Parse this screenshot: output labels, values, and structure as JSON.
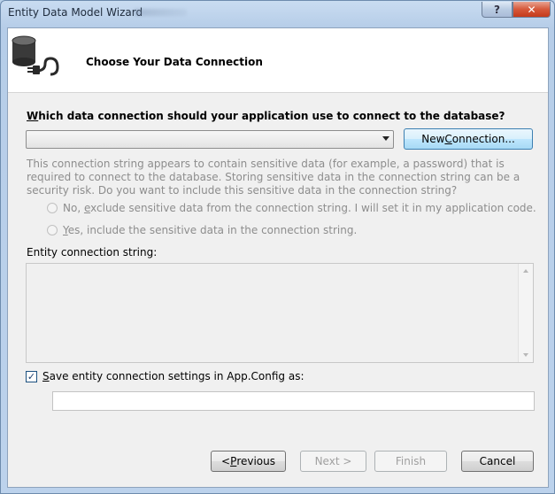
{
  "window": {
    "title": "Entity Data Model Wizard",
    "help_label": "?",
    "close_label": "✕"
  },
  "header": {
    "title": "Choose Your Data Connection"
  },
  "connection": {
    "question_prefix": "",
    "question_accel": "W",
    "question_rest": "hich data connection should your application use to connect to the database?",
    "selected": "",
    "new_connection_pre": "New ",
    "new_connection_accel": "C",
    "new_connection_post": "onnection..."
  },
  "sensitive": {
    "message": "This connection string appears to contain sensitive data (for example, a password) that is required to connect to the database. Storing sensitive data in the connection string can be a security risk. Do you want to include this sensitive data in the connection string?",
    "option_no_pre": "No, ",
    "option_no_accel": "e",
    "option_no_post": "xclude sensitive data from the connection string. I will set it in my application code.",
    "option_yes_pre": "",
    "option_yes_accel": "Y",
    "option_yes_post": "es, include the sensitive data in the connection string."
  },
  "entity": {
    "label": "Entity connection string:",
    "value": ""
  },
  "save": {
    "checked": true,
    "label_pre": "",
    "label_accel": "S",
    "label_post": "ave entity connection settings in App.Config as:",
    "value": ""
  },
  "buttons": {
    "previous_pre": "< ",
    "previous_accel": "P",
    "previous_post": "revious",
    "next": "Next >",
    "finish": "Finish",
    "cancel": "Cancel"
  }
}
